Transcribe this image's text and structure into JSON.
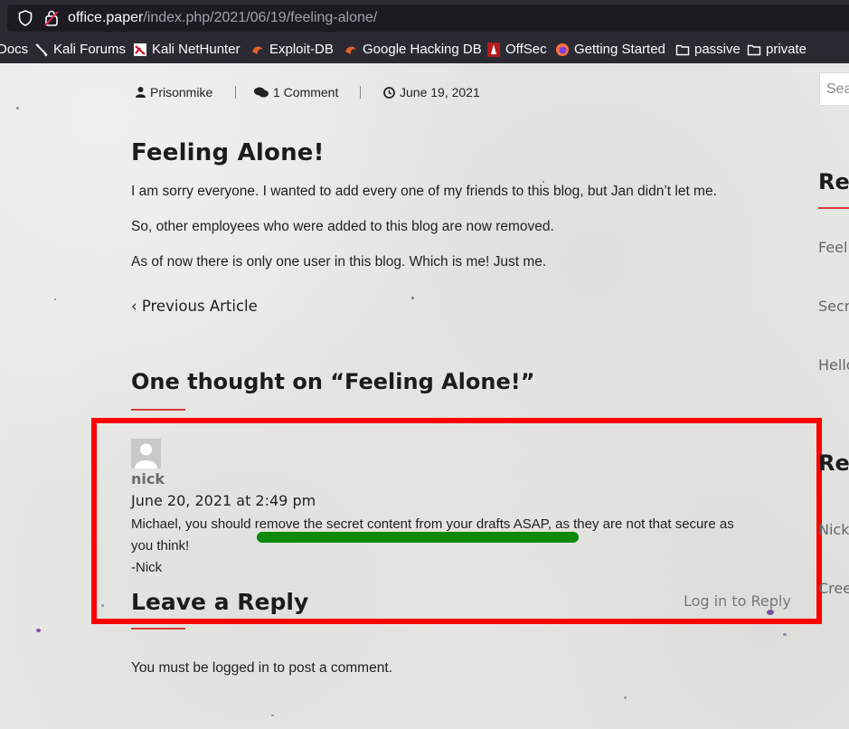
{
  "browser": {
    "url_host": "office.paper",
    "url_path": "/index.php/2021/06/19/feeling-alone/",
    "bookmarks": [
      {
        "label": "Docs",
        "icon": "docs-icon"
      },
      {
        "label": "Kali Forums",
        "icon": "kali-dragon-icon"
      },
      {
        "label": "Kali NetHunter",
        "icon": "nethunter-icon"
      },
      {
        "label": "Exploit-DB",
        "icon": "exploit-db-icon"
      },
      {
        "label": "Google Hacking DB",
        "icon": "ghdb-icon"
      },
      {
        "label": "OffSec",
        "icon": "offsec-icon"
      },
      {
        "label": "Getting Started",
        "icon": "firefox-icon"
      },
      {
        "label": "passive",
        "icon": "folder-icon"
      },
      {
        "label": "private",
        "icon": "folder-icon"
      }
    ]
  },
  "post": {
    "author": "Prisonmike",
    "comment_count": "1 Comment",
    "date": "June 19, 2021",
    "title": "Feeling Alone!",
    "paragraphs": [
      "I am sorry everyone. I wanted to add every one of my friends to this blog, but Jan didn’t let me.",
      "So, other employees who were added to this blog are now removed.",
      "As of now there is only one user in this blog. Which is me! Just me."
    ],
    "prev_article": "Previous Article"
  },
  "comments": {
    "heading": "One thought on “Feeling Alone!”",
    "items": [
      {
        "author": "nick",
        "date": "June 20, 2021 at 2:49 pm",
        "line1": "Michael, you should remove the secret content from your drafts ASAP, as they are not that secure as",
        "line2": "you think!",
        "signature": "-Nick"
      }
    ]
  },
  "reply": {
    "heading": "Leave a Reply",
    "login_link": "Log in to Reply",
    "notice": "You must be logged in to post a comment."
  },
  "sidebar": {
    "search_placeholder": "Sea",
    "heading1": "Re",
    "recent_posts": [
      "Feel",
      "Secr",
      "Hello"
    ],
    "heading2": "Re",
    "recent_comments": [
      "Nick",
      "Cree"
    ]
  },
  "colors": {
    "annotation_box": "#ff0000",
    "annotation_underline": "#0b8a0b",
    "accent": "#d63b3b"
  }
}
